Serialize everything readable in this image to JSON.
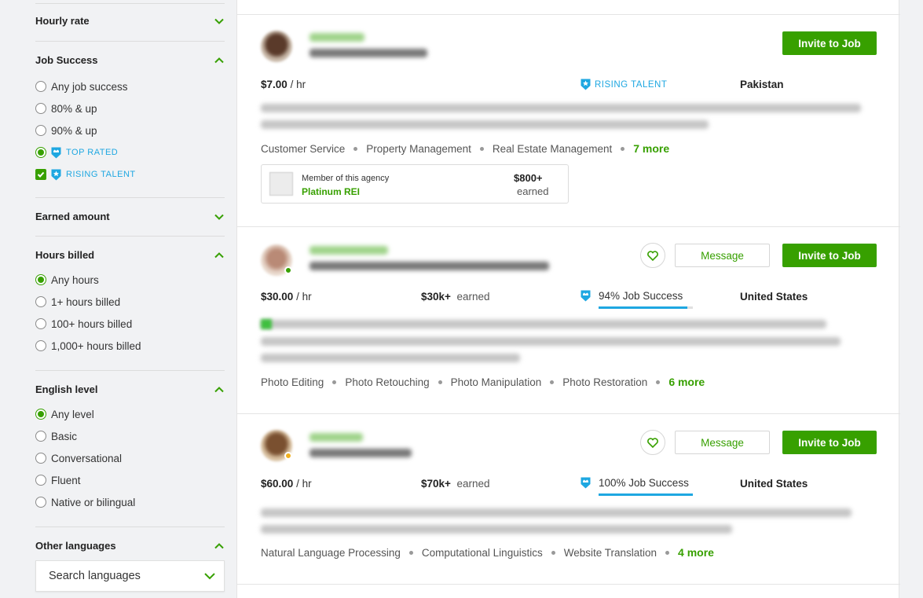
{
  "filters": {
    "hourly_rate": {
      "title": "Hourly rate"
    },
    "job_success": {
      "title": "Job Success",
      "options": [
        "Any job success",
        "80% & up",
        "90% & up"
      ],
      "top_rated": "TOP RATED",
      "rising_talent": "RISING TALENT"
    },
    "earned_amount": {
      "title": "Earned amount"
    },
    "hours_billed": {
      "title": "Hours billed",
      "options": [
        "Any hours",
        "1+ hours billed",
        "100+ hours billed",
        "1,000+ hours billed"
      ]
    },
    "english_level": {
      "title": "English level",
      "options": [
        "Any level",
        "Basic",
        "Conversational",
        "Fluent",
        "Native or bilingual"
      ]
    },
    "other_languages": {
      "title": "Other languages",
      "search_placeholder": "Search languages"
    }
  },
  "freelancers": [
    {
      "rate": "$7.00",
      "rate_unit": "/ hr",
      "badge": "RISING TALENT",
      "country": "Pakistan",
      "invite_label": "Invite to Job",
      "skills": [
        "Customer Service",
        "Property Management",
        "Real Estate Management"
      ],
      "more": "7 more",
      "agency": {
        "member_label": "Member of this agency",
        "name": "Platinum REI",
        "earned_amount": "$800+",
        "earned_label": "earned"
      }
    },
    {
      "rate": "$30.00",
      "rate_unit": "/ hr",
      "earned_amount": "$30k+",
      "earned_label": "earned",
      "job_success": "94% Job Success",
      "job_success_value": 0.94,
      "country": "United States",
      "message_label": "Message",
      "invite_label": "Invite to Job",
      "skills": [
        "Photo Editing",
        "Photo Retouching",
        "Photo Manipulation",
        "Photo Restoration"
      ],
      "more": "6 more"
    },
    {
      "rate": "$60.00",
      "rate_unit": "/ hr",
      "earned_amount": "$70k+",
      "earned_label": "earned",
      "job_success": "100% Job Success",
      "job_success_value": 1.0,
      "country": "United States",
      "message_label": "Message",
      "invite_label": "Invite to Job",
      "skills": [
        "Natural Language Processing",
        "Computational Linguistics",
        "Website Translation"
      ],
      "more": "4 more"
    }
  ],
  "colors": {
    "accent": "#37a000",
    "badge_blue": "#1ea7e1"
  }
}
